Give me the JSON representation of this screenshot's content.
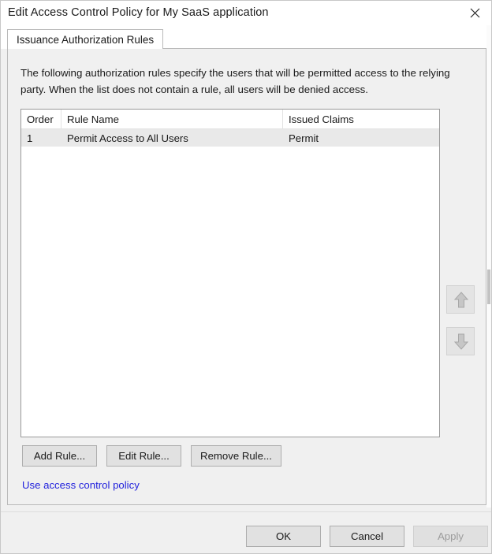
{
  "window": {
    "title": "Edit Access Control Policy for My SaaS application",
    "close_icon": "close-icon"
  },
  "tabs": [
    {
      "label": "Issuance Authorization Rules",
      "active": true
    }
  ],
  "panel": {
    "description": "The following authorization rules specify the users that will be permitted access to the relying party. When the list does not contain a rule, all users will be denied access."
  },
  "rules_list": {
    "columns": [
      "Order",
      "Rule Name",
      "Issued Claims"
    ],
    "rows": [
      {
        "order": "1",
        "rule_name": "Permit Access to All Users",
        "issued_claims": "Permit",
        "selected": true
      }
    ]
  },
  "reorder": {
    "move_up_icon": "arrow-up-icon",
    "move_down_icon": "arrow-down-icon",
    "move_up_enabled": false,
    "move_down_enabled": false
  },
  "actions": {
    "add_rule": "Add Rule...",
    "edit_rule": "Edit Rule...",
    "remove_rule": "Remove Rule..."
  },
  "link": {
    "use_access_control_policy": "Use access control policy"
  },
  "footer": {
    "ok": "OK",
    "cancel": "Cancel",
    "apply": "Apply",
    "apply_enabled": false
  },
  "colors": {
    "dialog_background": "#f0f0f0",
    "titlebar_background": "#ffffff",
    "link": "#2222dd",
    "selection": "#e9e9e9",
    "button_face": "#e1e1e1",
    "button_border": "#adadad",
    "disabled_text": "#9c9c9c"
  }
}
